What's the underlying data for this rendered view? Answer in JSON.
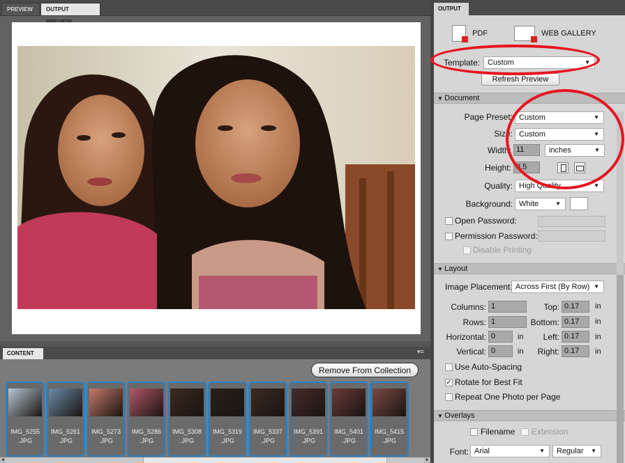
{
  "tabs": {
    "preview": "PREVIEW",
    "output_preview": "OUTPUT PREVIEW"
  },
  "content": {
    "tab": "CONTENT",
    "remove_button": "Remove From Collection",
    "thumbnails": [
      {
        "name": "IMG_5255",
        "ext": ".JPG"
      },
      {
        "name": "IMG_5261",
        "ext": ".JPG"
      },
      {
        "name": "IMG_5273",
        "ext": ".JPG"
      },
      {
        "name": "IMG_5286",
        "ext": ".JPG"
      },
      {
        "name": "IMG_5308",
        "ext": ".JPG"
      },
      {
        "name": "IMG_5319",
        "ext": ".JPG"
      },
      {
        "name": "IMG_5337",
        "ext": ".JPG"
      },
      {
        "name": "IMG_5391",
        "ext": ".JPG"
      },
      {
        "name": "IMG_5401",
        "ext": ".JPG"
      },
      {
        "name": "IMG_5415",
        "ext": ".JPG"
      }
    ]
  },
  "output": {
    "tab": "OUTPUT",
    "pdf_button": "PDF",
    "web_gallery_button": "WEB GALLERY",
    "template_label": "Template:",
    "template_value": "Custom",
    "refresh_button": "Refresh Preview"
  },
  "document": {
    "header": "Document",
    "page_preset_label": "Page Preset:",
    "page_preset_value": "Custom",
    "size_label": "Size:",
    "size_value": "Custom",
    "width_label": "Width:",
    "width_value": "11",
    "units_value": "inches",
    "height_label": "Height:",
    "height_value": "8.5",
    "quality_label": "Quality:",
    "quality_value": "High Quality",
    "background_label": "Background:",
    "background_value": "White",
    "open_password_label": "Open Password:",
    "permission_password_label": "Permission Password:",
    "disable_printing_label": "Disable Printing"
  },
  "layout": {
    "header": "Layout",
    "image_placement_label": "Image Placement:",
    "image_placement_value": "Across First (By Row)",
    "columns_label": "Columns:",
    "columns_value": "1",
    "rows_label": "Rows:",
    "rows_value": "1",
    "horizontal_label": "Horizontal:",
    "horizontal_value": "0",
    "vertical_label": "Vertical:",
    "vertical_value": "0",
    "top_label": "Top:",
    "top_value": "0.17",
    "bottom_label": "Bottom:",
    "bottom_value": "0.17",
    "left_label": "Left:",
    "left_value": "0.17",
    "right_label": "Right:",
    "right_value": "0.17",
    "unit": "in",
    "use_auto_spacing_label": "Use Auto-Spacing",
    "rotate_label": "Rotate for Best Fit",
    "repeat_label": "Repeat One Photo per Page"
  },
  "overlays": {
    "header": "Overlays",
    "filename_label": "Filename",
    "extension_label": "Extension",
    "font_label": "Font:",
    "font_value": "Arial",
    "style_value": "Regular"
  },
  "colors": {
    "annotation": "#e8121e",
    "selection": "#2a82c6"
  },
  "icons": {
    "pdf": "pdf-document-icon",
    "web_gallery": "web-gallery-icon",
    "page_orientation_portrait": "portrait-orientation-icon",
    "page_orientation_landscape": "landscape-orientation-icon"
  }
}
